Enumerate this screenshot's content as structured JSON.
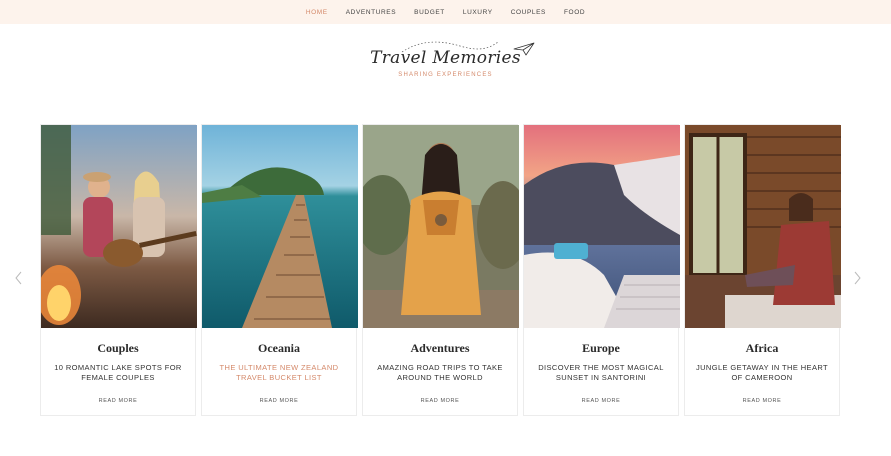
{
  "nav": {
    "items": [
      {
        "label": "HOME",
        "active": true
      },
      {
        "label": "ADVENTURES",
        "active": false
      },
      {
        "label": "BUDGET",
        "active": false
      },
      {
        "label": "LUXURY",
        "active": false
      },
      {
        "label": "COUPLES",
        "active": false
      },
      {
        "label": "FOOD",
        "active": false
      }
    ]
  },
  "brand": {
    "title": "Travel Memories",
    "tagline": "SHARING EXPERIENCES",
    "accent_color": "#d4896a",
    "nav_bg": "#fdf3ec"
  },
  "slider": {
    "prev_icon": "chevron-left-icon",
    "next_icon": "chevron-right-icon",
    "cards": [
      {
        "category": "Couples",
        "excerpt": "10 ROMANTIC LAKE SPOTS FOR FEMALE COUPLES",
        "read_more": "READ MORE",
        "highlight": false
      },
      {
        "category": "Oceania",
        "excerpt": "THE ULTIMATE NEW ZEALAND TRAVEL BUCKET LIST",
        "read_more": "READ MORE",
        "highlight": true
      },
      {
        "category": "Adventures",
        "excerpt": "AMAZING ROAD TRIPS TO TAKE AROUND THE WORLD",
        "read_more": "READ MORE",
        "highlight": false
      },
      {
        "category": "Europe",
        "excerpt": "DISCOVER THE MOST MAGICAL SUNSET IN SANTORINI",
        "read_more": "READ MORE",
        "highlight": false
      },
      {
        "category": "Africa",
        "excerpt": "JUNGLE GETAWAY IN THE HEART OF CAMEROON",
        "read_more": "READ MORE",
        "highlight": false
      }
    ]
  }
}
